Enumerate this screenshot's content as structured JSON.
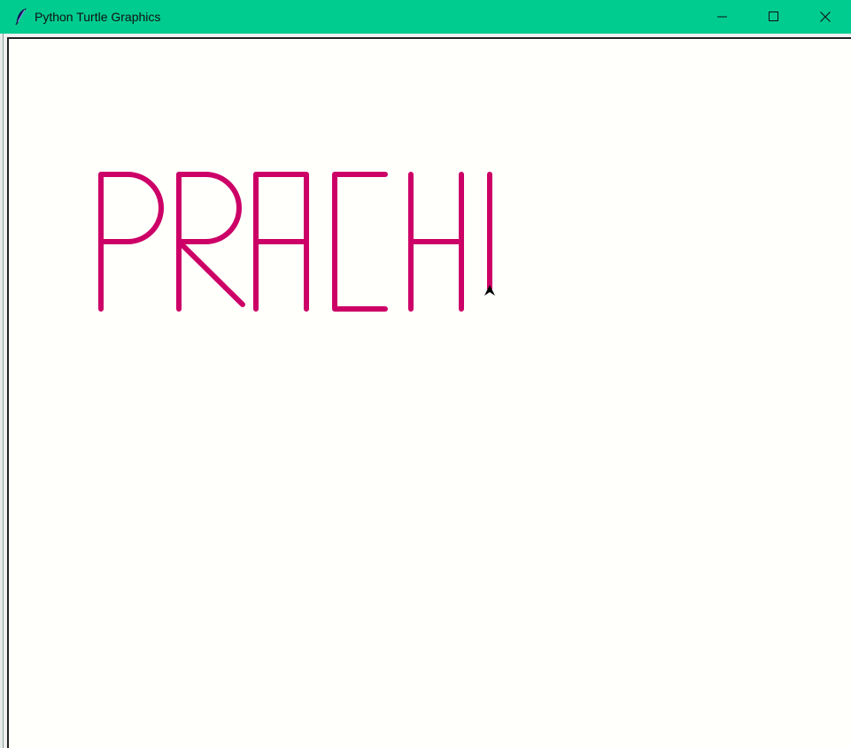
{
  "window": {
    "title": "Python Turtle Graphics",
    "titlebar_color": "#00cc8f",
    "canvas_bg": "#fffffb"
  },
  "controls": {
    "minimize_icon": "minimize-icon",
    "maximize_icon": "maximize-icon",
    "close_icon": "close-icon"
  },
  "drawing": {
    "text": "PRACHI",
    "pen_color": "#cc0066",
    "turtle_color": "#000000"
  }
}
